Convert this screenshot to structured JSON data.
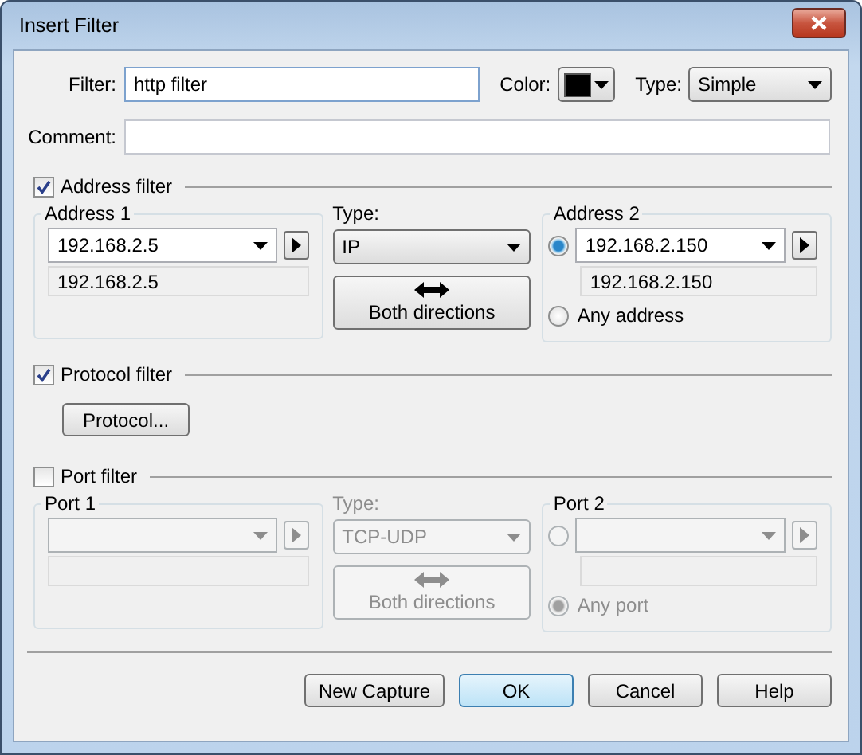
{
  "window": {
    "title": "Insert Filter"
  },
  "filter": {
    "label": "Filter:",
    "value": "http filter"
  },
  "color": {
    "label": "Color:",
    "color": "#000000"
  },
  "type": {
    "label": "Type:",
    "value": "Simple"
  },
  "comment": {
    "label": "Comment:"
  },
  "address_filter": {
    "label": "Address filter",
    "checked": true,
    "side1": {
      "title": "Address 1",
      "value": "192.168.2.5",
      "resolved": "192.168.2.5"
    },
    "type": {
      "label": "Type:",
      "value": "IP"
    },
    "direction_button": "Both directions",
    "side2": {
      "title": "Address 2",
      "selected": true,
      "value": "192.168.2.150",
      "resolved": "192.168.2.150",
      "any_label": "Any address",
      "any_selected": false
    }
  },
  "protocol_filter": {
    "label": "Protocol filter",
    "checked": true,
    "button": "Protocol..."
  },
  "port_filter": {
    "label": "Port filter",
    "checked": false,
    "side1": {
      "title": "Port 1"
    },
    "type": {
      "label": "Type:",
      "value": "TCP-UDP"
    },
    "direction_button": "Both directions",
    "side2": {
      "title": "Port 2",
      "selected": false,
      "any_label": "Any port",
      "any_selected": true
    }
  },
  "buttons": [
    {
      "label": "New Capture",
      "default": false
    },
    {
      "label": "OK",
      "default": true
    },
    {
      "label": "Cancel",
      "default": false
    },
    {
      "label": "Help",
      "default": false
    }
  ]
}
